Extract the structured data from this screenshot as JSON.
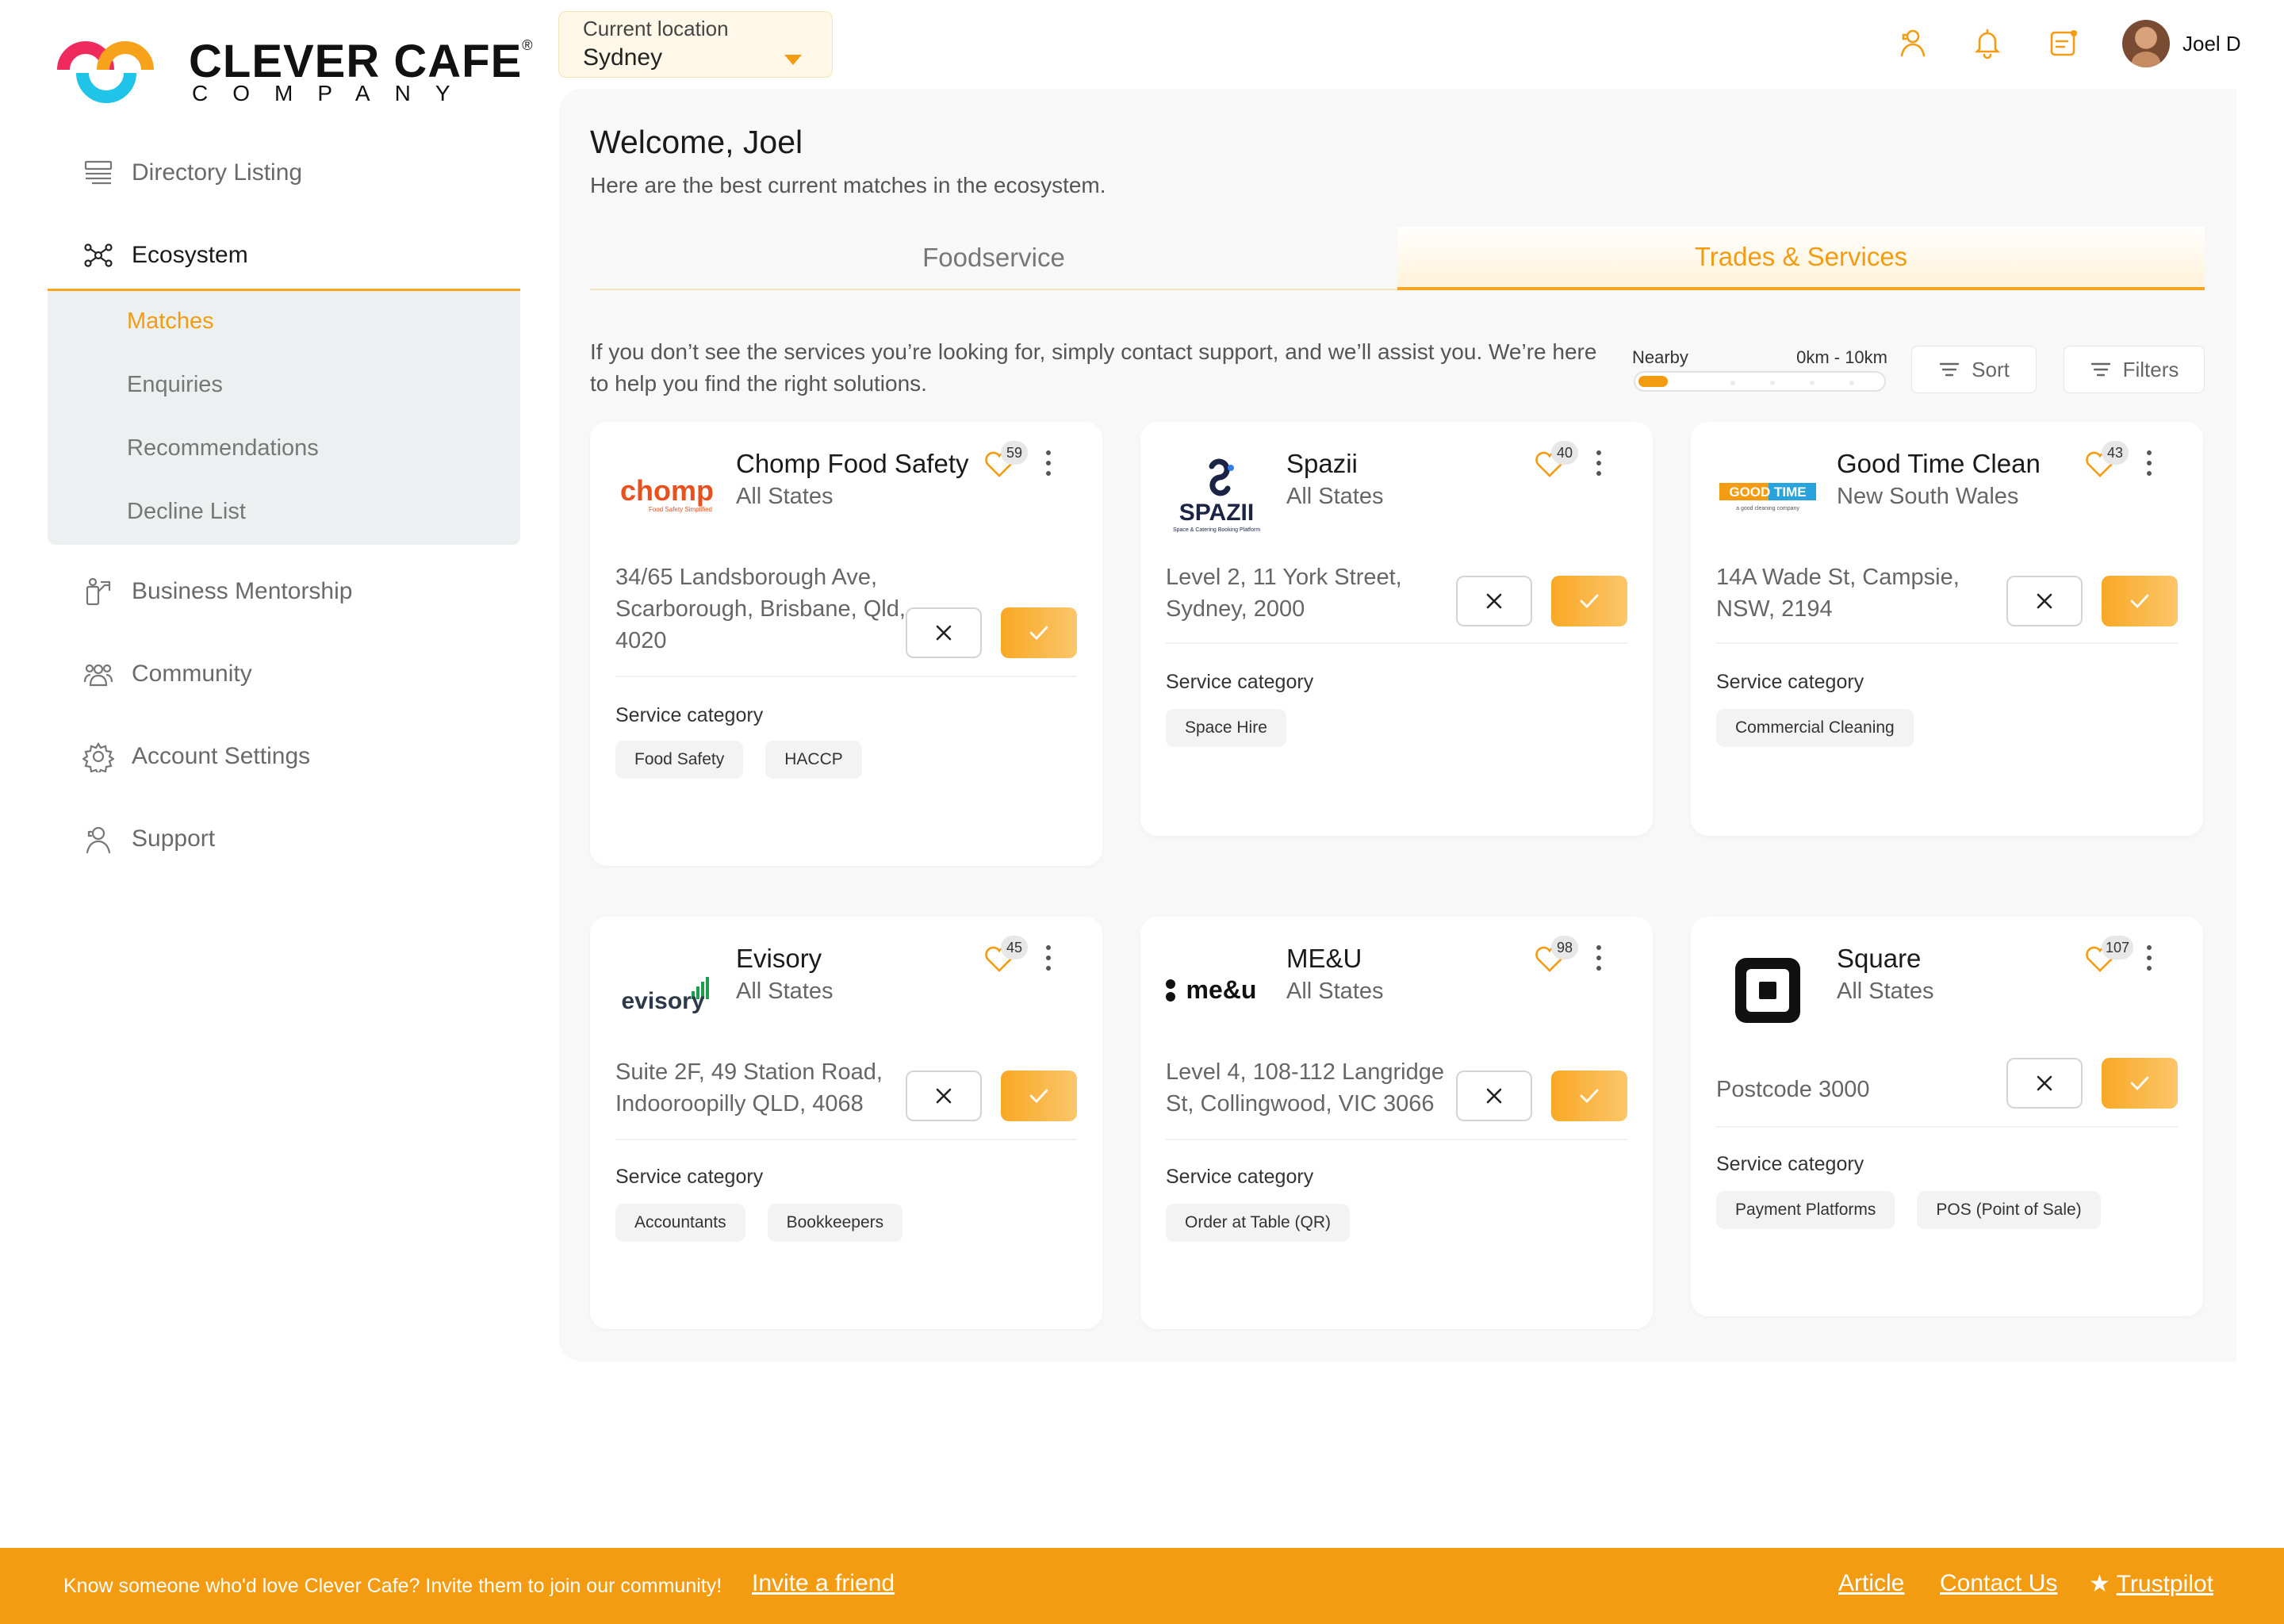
{
  "brand": {
    "name": "CLEVER CAFE",
    "registered": "®",
    "tagline": "COMPANY"
  },
  "location": {
    "label": "Current location",
    "value": "Sydney"
  },
  "header": {
    "user_name": "Joel D",
    "icons": [
      "contact-person-icon",
      "bell-icon",
      "clipboard-icon"
    ]
  },
  "sidebar": {
    "items": [
      {
        "label": "Directory Listing",
        "icon": "list-icon"
      },
      {
        "label": "Ecosystem",
        "icon": "network-icon"
      },
      {
        "label": "Business Mentorship",
        "icon": "mentorship-icon"
      },
      {
        "label": "Community",
        "icon": "community-icon"
      },
      {
        "label": "Account Settings",
        "icon": "gear-icon"
      },
      {
        "label": "Support",
        "icon": "support-icon"
      }
    ],
    "subitems": [
      {
        "label": "Matches"
      },
      {
        "label": "Enquiries"
      },
      {
        "label": "Recommendations"
      },
      {
        "label": "Decline List"
      }
    ]
  },
  "main": {
    "welcome": "Welcome, Joel",
    "subtitle": "Here are the best current matches in the ecosystem.",
    "tabs": [
      {
        "label": "Foodservice"
      },
      {
        "label": "Trades & Services"
      }
    ],
    "info": "If you don’t see the services you’re looking for, simply contact support, and we’ll assist you. We’re here to help you find the right solutions.",
    "nearby": {
      "label": "Nearby",
      "range": "0km - 10km",
      "level": 0.12
    },
    "sort_label": "Sort",
    "filters_label": "Filters"
  },
  "cards": [
    {
      "name": "Chomp Food Safety",
      "region": "All States",
      "likes": "59",
      "address": "34/65 Landsborough Ave, Scarborough, Brisbane, Qld, 4020",
      "category_label": "Service category",
      "tags": [
        "Food Safety",
        "HACCP"
      ],
      "logo_text": "chomp",
      "logo_sub": "Food Safety Simplified"
    },
    {
      "name": "Spazii",
      "region": "All States",
      "likes": "40",
      "address": "Level 2, 11 York Street, Sydney, 2000",
      "category_label": "Service category",
      "tags": [
        "Space Hire"
      ],
      "logo_text": "SPAZII",
      "logo_sub": "Space & Catering Booking Platform"
    },
    {
      "name": "Good Time Clean",
      "region": "New South Wales",
      "likes": "43",
      "address": "14A Wade St, Campsie, NSW, 2194",
      "category_label": "Service category",
      "tags": [
        "Commercial Cleaning"
      ],
      "logo_text": "GOOD TIME",
      "logo_sub": "a good cleaning company"
    },
    {
      "name": "Evisory",
      "region": "All States",
      "likes": "45",
      "address": "Suite 2F, 49 Station Road, Indooroopilly QLD, 4068",
      "category_label": "Service category",
      "tags": [
        "Accountants",
        "Bookkeepers"
      ],
      "logo_text": "evisory"
    },
    {
      "name": "ME&U",
      "region": "All States",
      "likes": "98",
      "address": "Level 4, 108-112 Langridge St, Collingwood, VIC 3066",
      "category_label": "Service category",
      "tags": [
        "Order at Table (QR)"
      ],
      "logo_text": "me&u"
    },
    {
      "name": "Square",
      "region": "All States",
      "likes": "107",
      "address": "Postcode 3000",
      "category_label": "Service category",
      "tags": [
        "Payment Platforms",
        "POS (Point of Sale)"
      ]
    }
  ],
  "footer": {
    "text": "Know someone who'd love Clever Cafe? Invite them to join our community!",
    "invite": "Invite a friend",
    "article": "Article",
    "contact": "Contact Us",
    "trustpilot": "Trustpilot"
  },
  "colors": {
    "accent": "#f39c12",
    "accent_light": "#fff3d9",
    "logo_red": "#ef2a5c",
    "logo_orange": "#f7a21b",
    "logo_cyan": "#1fc4e8"
  }
}
